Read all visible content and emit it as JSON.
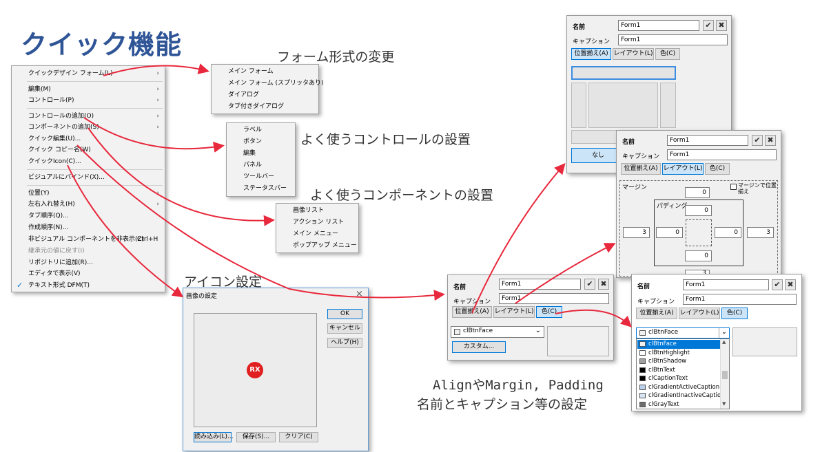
{
  "title": "クイック機能",
  "notes": {
    "form_change": "フォーム形式の変更",
    "controls": "よく使うコントロールの設置",
    "components": "よく使うコンポーネントの設置",
    "icon": "アイコン設定",
    "align_line1": "AlignやMargin, Padding",
    "align_line2": "名前とキャプション等の設定"
  },
  "context_menu": {
    "items": [
      {
        "label": "クイックデザイン フォーム(L)",
        "submenu": true
      },
      {
        "label": "編集(M)",
        "submenu": true
      },
      {
        "label": "コントロール(P)",
        "submenu": true
      },
      {
        "label": "コントロールの追加(O)",
        "submenu": true
      },
      {
        "label": "コンポーネントの追加(S)",
        "submenu": true
      },
      {
        "label": "クイック編集(U)..."
      },
      {
        "label": "クイック コピー名(W)"
      },
      {
        "label": "クイックIcon(C)..."
      },
      {
        "label": "ビジュアルにバインド(X)..."
      },
      {
        "label": "位置(Y)",
        "submenu": true
      },
      {
        "label": "左右入れ替え(H)",
        "submenu": true
      },
      {
        "label": "タブ順序(Q)..."
      },
      {
        "label": "作成順序(N)..."
      },
      {
        "label": "非ビジュアル コンポーネントを非表示(Z)",
        "shortcut": "Ctrl+H"
      },
      {
        "label": "継承元の値に戻す(I)",
        "disabled": true
      },
      {
        "label": "リポジトリに追加(R)..."
      },
      {
        "label": "エディタで表示(V)"
      },
      {
        "label": "テキスト形式 DFM(T)",
        "checked": true
      }
    ]
  },
  "form_menu": [
    "メイン フォーム",
    "メイン フォーム (スプリッタあり)",
    "ダイアログ",
    "タブ付きダイアログ"
  ],
  "control_menu": [
    "ラベル",
    "ボタン",
    "編集",
    "パネル",
    "ツールバー",
    "ステータスバー"
  ],
  "component_menu": [
    "画像リスト",
    "アクション リスト",
    "メイン メニュー",
    "ポップアップ メニュー"
  ],
  "image_dialog": {
    "title": "画像の設定",
    "close": "×",
    "ok": "OK",
    "cancel": "キャンセル",
    "help": "ヘルプ(H)",
    "load": "読み込み(L)...",
    "save": "保存(S)...",
    "clear": "クリア(C)",
    "icon_text": "RX"
  },
  "quick_edit": {
    "name_label": "名前",
    "caption_label": "キャプション",
    "name_value": "Form1",
    "caption_value": "Form1",
    "ok_glyph": "✔",
    "cancel_glyph": "✖",
    "tab_align": "位置揃え(A)",
    "tab_layout": "レイアウト(L)",
    "tab_color": "色(C)",
    "none_button": "なし",
    "custom_button": "カスタム...",
    "color_value": "clBtnFace",
    "margin_label": "マージン",
    "margin_check_label": "マージンで位置揃え",
    "padding_label": "パディング",
    "margin": {
      "top": "0",
      "left": "3",
      "right": "3",
      "bottom": "3"
    },
    "padding": {
      "top": "0",
      "left": "0",
      "right": "0",
      "bottom": "0"
    }
  },
  "color_list": [
    {
      "name": "clBtnFace",
      "color": "#f0f0f0",
      "selected": true
    },
    {
      "name": "clBtnHighlight",
      "color": "#ffffff"
    },
    {
      "name": "clBtnShadow",
      "color": "#a0a0a0"
    },
    {
      "name": "clBtnText",
      "color": "#000000"
    },
    {
      "name": "clCaptionText",
      "color": "#000000"
    },
    {
      "name": "clGradientActiveCaption",
      "color": "#b9d1ea"
    },
    {
      "name": "clGradientInactiveCaption",
      "color": "#d7e4f2"
    },
    {
      "name": "clGrayText",
      "color": "#6d6d6d"
    }
  ],
  "colors": {
    "accent": "#0078d7",
    "title": "#2f5597",
    "arrow": "#e8283c",
    "icon_badge": "#e02020"
  }
}
